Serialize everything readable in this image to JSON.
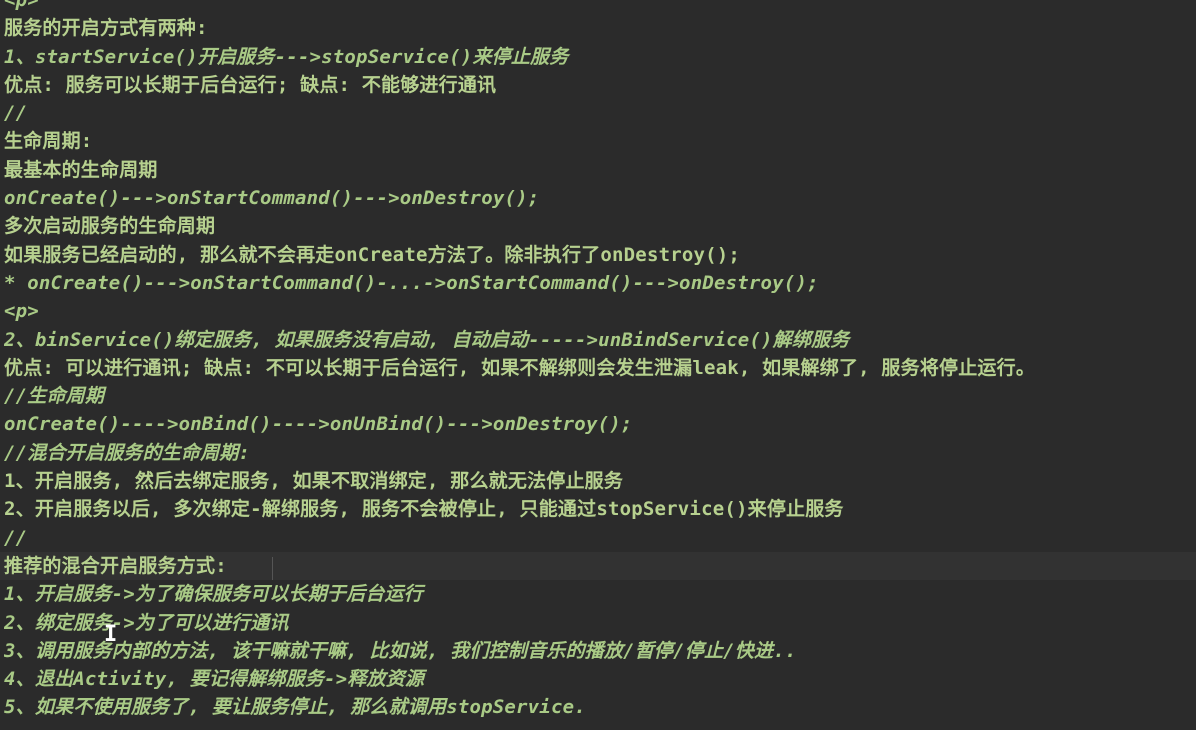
{
  "lines": [
    "<p>",
    "服务的开启方式有两种:",
    "1、startService()开启服务--->stopService()来停止服务",
    "优点: 服务可以长期于后台运行; 缺点: 不能够进行通讯",
    "//",
    "生命周期:",
    "最基本的生命周期",
    "onCreate()--->onStartCommand()--->onDestroy();",
    "多次启动服务的生命周期",
    "如果服务已经启动的, 那么就不会再走onCreate方法了。除非执行了onDestroy();",
    "* onCreate()--->onStartCommand()-...->onStartCommand()--->onDestroy();",
    "<p>",
    "2、binService()绑定服务, 如果服务没有启动, 自动启动----->unBindService()解绑服务",
    "优点: 可以进行通讯; 缺点: 不可以长期于后台运行, 如果不解绑则会发生泄漏leak, 如果解绑了, 服务将停止运行。",
    "//生命周期",
    "onCreate()---->onBind()---->onUnBind()--->onDestroy();",
    "//混合开启服务的生命周期:",
    "1、开启服务, 然后去绑定服务, 如果不取消绑定, 那么就无法停止服务",
    "2、开启服务以后, 多次绑定-解绑服务, 服务不会被停止, 只能通过stopService()来停止服务",
    "//",
    "推荐的混合开启服务方式:",
    "1、开启服务->为了确保服务可以长期于后台运行",
    "2、绑定服务->为了可以进行通讯",
    "3、调用服务内部的方法, 该干嘛就干嘛, 比如说, 我们控制音乐的播放/暂停/停止/快进..",
    "4、退出Activity, 要记得解绑服务->释放资源",
    "5、如果不使用服务了, 要让服务停止, 那么就调用stopService."
  ],
  "colors": {
    "background": "#2b2b2b",
    "text": "#a9ca86",
    "current_line": "#323232"
  }
}
